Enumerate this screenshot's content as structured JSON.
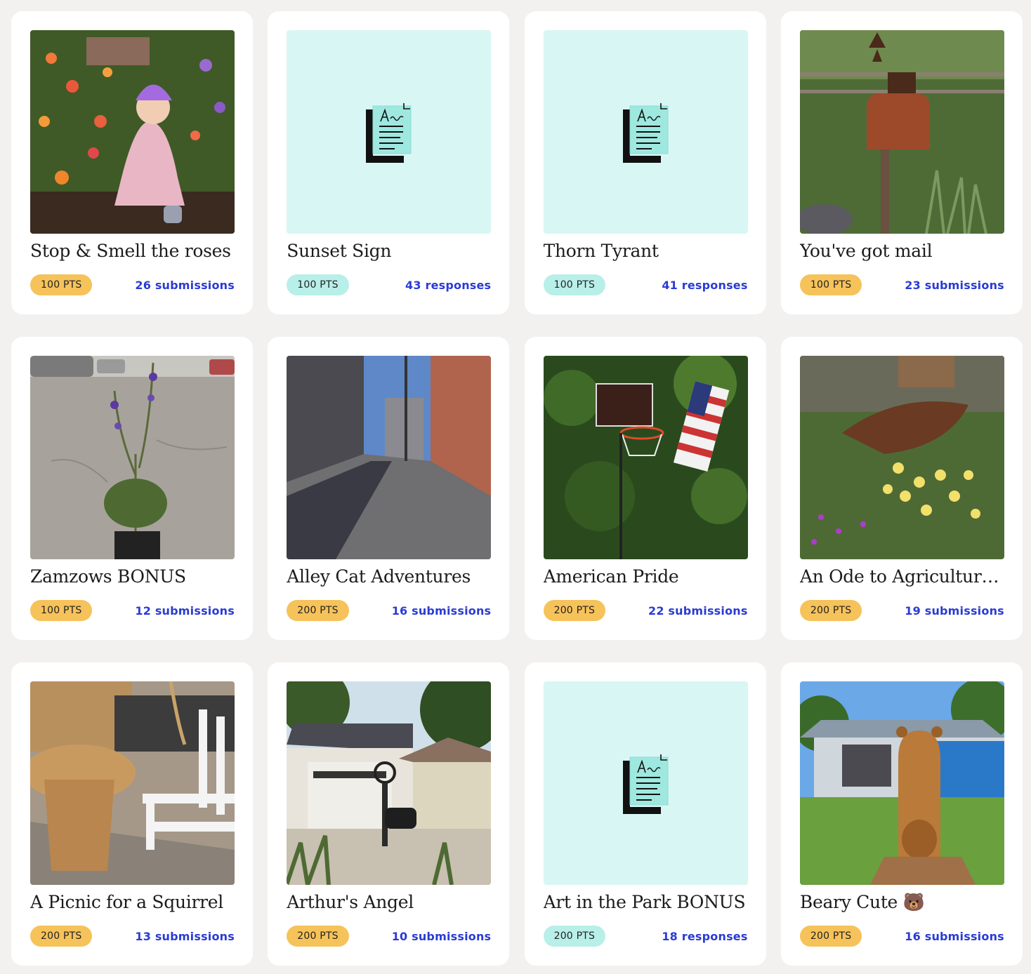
{
  "accent_colors": {
    "link": "#2a3bd4",
    "points_gold": "#f6c25a",
    "points_aqua": "#b8efe9",
    "placeholder_bg": "#d8f6f4"
  },
  "cards": [
    {
      "title": "Stop & Smell the roses",
      "points": "100 PTS",
      "count": "26 submissions",
      "kind": "photo",
      "image": "girl-with-flowers-photo"
    },
    {
      "title": "Sunset Sign",
      "points": "100 PTS",
      "count": "43 responses",
      "kind": "form",
      "image": "document-form-icon"
    },
    {
      "title": "Thorn Tyrant",
      "points": "100 PTS",
      "count": "41 responses",
      "kind": "form",
      "image": "document-form-icon"
    },
    {
      "title": "You've got mail",
      "points": "100 PTS",
      "count": "23 submissions",
      "kind": "photo",
      "image": "rusty-mailbox-photo"
    },
    {
      "title": "Zamzows BONUS",
      "points": "100 PTS",
      "count": "12 submissions",
      "kind": "photo",
      "image": "potted-plant-parking-lot-photo"
    },
    {
      "title": "Alley Cat Adventures",
      "points": "200 PTS",
      "count": "16 submissions",
      "kind": "photo",
      "image": "city-alley-photo"
    },
    {
      "title": "American Pride",
      "points": "200 PTS",
      "count": "22 submissions",
      "kind": "photo",
      "image": "basketball-hoop-flag-photo"
    },
    {
      "title": "An Ode to Agriculture ...",
      "points": "200 PTS",
      "count": "19 submissions",
      "kind": "photo",
      "image": "plow-garden-photo"
    },
    {
      "title": "A Picnic for a Squirrel",
      "points": "200 PTS",
      "count": "13 submissions",
      "kind": "photo",
      "image": "tiny-picnic-table-photo"
    },
    {
      "title": "Arthur's Angel",
      "points": "200 PTS",
      "count": "10 submissions",
      "kind": "photo",
      "image": "metal-sculpture-garage-photo"
    },
    {
      "title": "Art in the Park BONUS",
      "points": "200 PTS",
      "count": "18 responses",
      "kind": "form",
      "image": "document-form-icon"
    },
    {
      "title": "Beary Cute 🐻",
      "points": "200 PTS",
      "count": "16 submissions",
      "kind": "photo",
      "image": "bear-carving-photo"
    }
  ]
}
